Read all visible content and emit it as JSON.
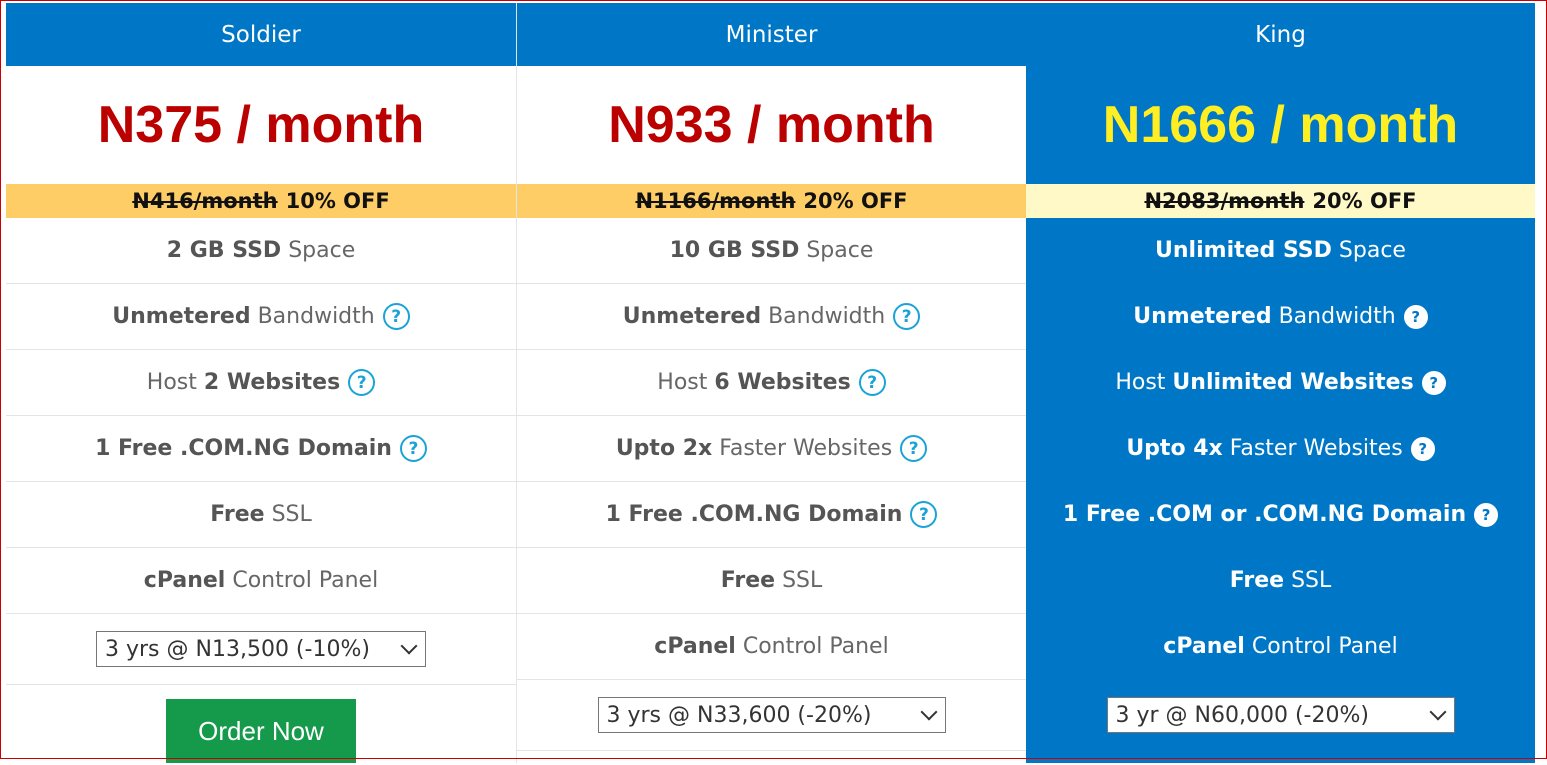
{
  "plans": [
    {
      "name": "Soldier",
      "price": "N375 / month",
      "old_price": "N416/month",
      "discount": "10% OFF",
      "features": [
        {
          "bold": "2 GB SSD",
          "text": "Space",
          "help": false
        },
        {
          "bold": "Unmetered",
          "text": "Bandwidth",
          "help": true
        },
        {
          "pre": "Host",
          "bold": "2 Websites",
          "text": "",
          "help": true
        },
        {
          "bold": "1 Free .COM.NG Domain",
          "text": "",
          "help": true
        },
        {
          "bold": "Free",
          "text": "SSL",
          "help": false
        },
        {
          "bold": "cPanel",
          "text": "Control Panel",
          "help": false
        }
      ],
      "term_select": "3 yrs @ N13,500 (-10%)",
      "order_label": "Order Now"
    },
    {
      "name": "Minister",
      "price": "N933 / month",
      "old_price": "N1166/month",
      "discount": "20% OFF",
      "features": [
        {
          "bold": "10 GB SSD",
          "text": "Space",
          "help": false
        },
        {
          "bold": "Unmetered",
          "text": "Bandwidth",
          "help": true
        },
        {
          "pre": "Host",
          "bold": "6 Websites",
          "text": "",
          "help": true
        },
        {
          "bold": "Upto 2x",
          "text": "Faster Websites",
          "help": true
        },
        {
          "bold": "1 Free .COM.NG Domain",
          "text": "",
          "help": true
        },
        {
          "bold": "Free",
          "text": "SSL",
          "help": false
        },
        {
          "bold": "cPanel",
          "text": "Control Panel",
          "help": false
        }
      ],
      "term_select": "3 yrs @ N33,600 (-20%)"
    },
    {
      "name": "King",
      "price": "N1666 / month",
      "old_price": "N2083/month",
      "discount": "20% OFF",
      "features": [
        {
          "bold": "Unlimited SSD",
          "text": "Space",
          "help": false
        },
        {
          "bold": "Unmetered",
          "text": "Bandwidth",
          "help": true
        },
        {
          "pre": "Host",
          "bold": "Unlimited Websites",
          "text": "",
          "help": true
        },
        {
          "bold": "Upto 4x",
          "text": "Faster Websites",
          "help": true
        },
        {
          "bold": "1 Free .COM or .COM.NG Domain",
          "text": "",
          "help": true
        },
        {
          "bold": "Free",
          "text": "SSL",
          "help": false
        },
        {
          "bold": "cPanel",
          "text": "Control Panel",
          "help": false
        }
      ],
      "term_select": "3 yr @ N60,000 (-20%)"
    }
  ],
  "icons": {
    "help": "question-circle-icon",
    "dropdown": "chevron-down-icon"
  },
  "colors": {
    "header": "#0077c6",
    "price": "#bb0000",
    "featured_price": "#ffee22",
    "discount_band": "#ffcd66",
    "order_button": "#149a4a"
  }
}
